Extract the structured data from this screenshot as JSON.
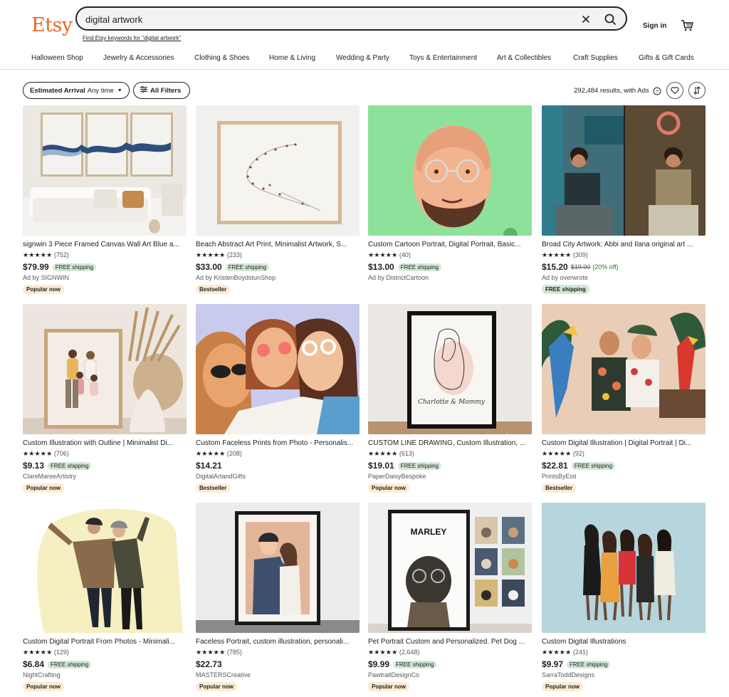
{
  "header": {
    "logo": "Etsy",
    "search_value": "digital artwork",
    "keywords_link": "Find Etsy keywords for \"digital artwork\"",
    "signin": "Sign in"
  },
  "categories": [
    "Halloween Shop",
    "Jewelry & Accessories",
    "Clothing & Shoes",
    "Home & Living",
    "Wedding & Party",
    "Toys & Entertainment",
    "Art & Collectibles",
    "Craft Supplies",
    "Gifts & Gift Cards"
  ],
  "filters": {
    "arrival_label": "Estimated Arrival",
    "arrival_value": "Any time",
    "all_filters": "All Filters",
    "results": "292,484 results, with Ads"
  },
  "products": [
    {
      "title": "signwin 3 Piece Framed Canvas Wall Art Blue a...",
      "stars": "★★★★★",
      "reviews": "(752)",
      "price": "$79.99",
      "free_shipping": "FREE shipping",
      "shop": "Ad by SIGNWIN",
      "badge": "Popular now"
    },
    {
      "title": "Beach Abstract Art Print, Minimalist Artwork, S...",
      "stars": "★★★★★",
      "reviews": "(233)",
      "price": "$33.00",
      "free_shipping": "FREE shipping",
      "shop": "Ad by KristenBoydstunShop",
      "badge": "Bestseller"
    },
    {
      "title": "Custom Cartoon Portrait, Digital Portrait, Basic...",
      "stars": "★★★★★",
      "reviews": "(40)",
      "price": "$13.00",
      "free_shipping": "FREE shipping",
      "shop": "Ad by DistrictCartoon",
      "badge": ""
    },
    {
      "title": "Broad City Artwork: Abbi and Ilana original art ...",
      "stars": "★★★★★",
      "reviews": "(309)",
      "price": "$15.20",
      "original_price": "$19.00",
      "discount": "(20% off)",
      "shop": "Ad by overwrote",
      "ship_badge": "FREE shipping"
    },
    {
      "title": "Custom Illustration with Outline | Minimalist Di...",
      "stars": "★★★★★",
      "reviews": "(706)",
      "price": "$9.13",
      "free_shipping": "FREE shipping",
      "shop": "ClareMareeArtistry",
      "badge": "Popular now"
    },
    {
      "title": "Custom Faceless Prints from Photo - Personalis...",
      "stars": "★★★★★",
      "reviews": "(208)",
      "price": "$14.21",
      "shop": "DigitalArtandGifts",
      "badge": "Bestseller"
    },
    {
      "title": "CUSTOM LINE DRAWING, Custom Illustration, ...",
      "stars": "★★★★★",
      "reviews": "(613)",
      "price": "$19.01",
      "free_shipping": "FREE shipping",
      "shop": "PaperDaisyBespoke",
      "badge": "Popular now"
    },
    {
      "title": "Custom Digital Illustration | Digital Portrait | Di...",
      "stars": "★★★★★",
      "reviews": "(92)",
      "price": "$22.81",
      "free_shipping": "FREE shipping",
      "shop": "PrintsByEsti",
      "badge": "Bestseller"
    },
    {
      "title": "Custom Digital Portrait From Photos - Minimali...",
      "stars": "★★★★★",
      "reviews": "(129)",
      "price": "$6.84",
      "free_shipping": "FREE shipping",
      "shop": "NightCrafting",
      "badge": "Popular now"
    },
    {
      "title": "Faceless Portrait, custom illustration, personali...",
      "stars": "★★★★★",
      "reviews": "(785)",
      "price": "$22.73",
      "shop": "MASTERSCreative",
      "badge": "Popular now"
    },
    {
      "title": "Pet Portrait Custom and Personalized. Pet Dog ...",
      "stars": "★★★★★",
      "reviews": "(2,648)",
      "price": "$9.99",
      "free_shipping": "FREE shipping",
      "shop": "PawtraitDesignCo",
      "badge": "Popular now"
    },
    {
      "title": "Custom Digital Illustrations",
      "stars": "★★★★★",
      "reviews": "(241)",
      "price": "$9.97",
      "free_shipping": "FREE shipping",
      "shop": "SarraToddDesigns",
      "badge": "Popular now"
    }
  ],
  "artwork": {
    "pet_name": "MARLEY"
  },
  "colors": {
    "brand": "#f1641e",
    "free_shipping_bg": "#d4e9d7",
    "badge_bg": "#fdebd2",
    "discount": "#2b7a28"
  }
}
